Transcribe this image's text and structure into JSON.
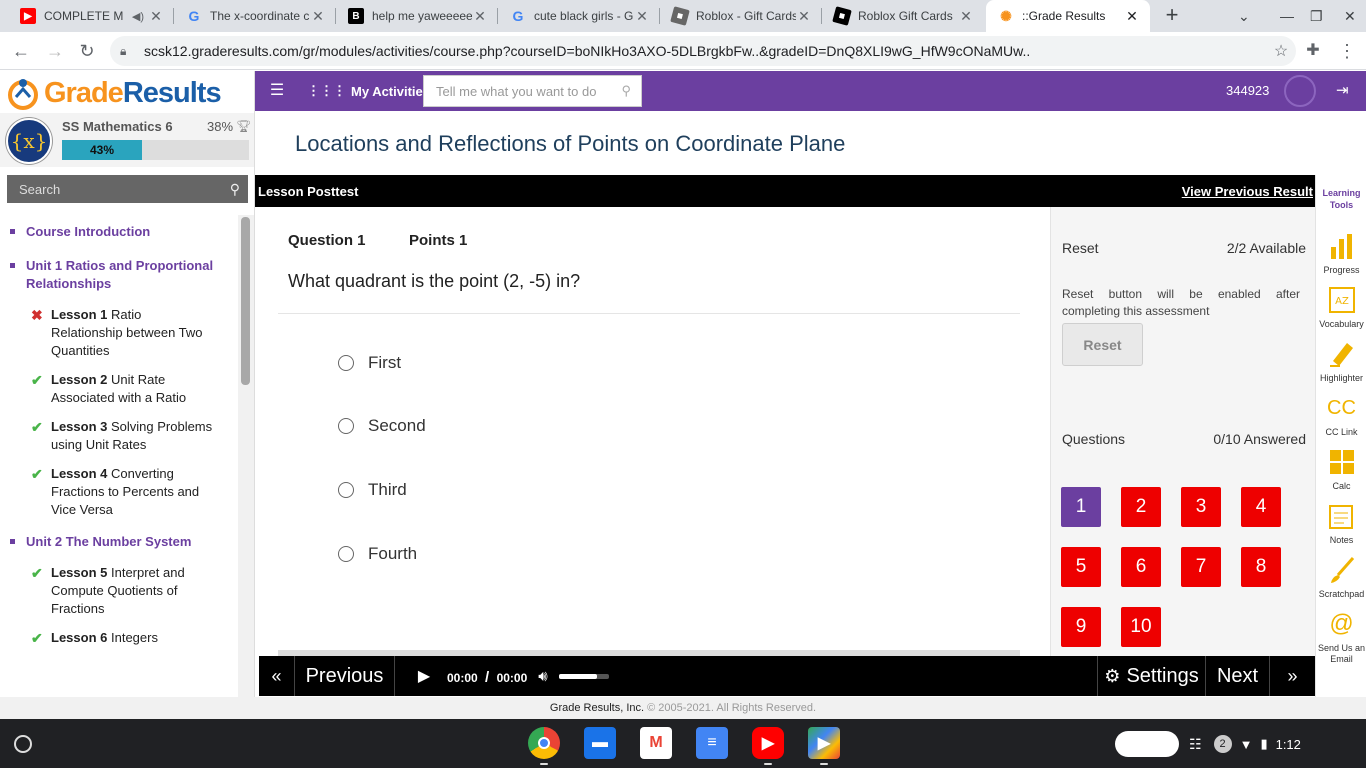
{
  "browser": {
    "tabs": [
      {
        "title": "COMPLETE M",
        "favicon": "youtube-icon",
        "color": "#ff0000"
      },
      {
        "title": "The x-coordinate c",
        "favicon": "google-icon",
        "color": "#4285f4"
      },
      {
        "title": "help me yaweeeee",
        "favicon": "brainly-icon",
        "color": "#000000"
      },
      {
        "title": "cute black girls - G",
        "favicon": "google-icon",
        "color": "#4285f4"
      },
      {
        "title": "Roblox - Gift Cards",
        "favicon": "roblox-icon",
        "color": "#555555"
      },
      {
        "title": "Roblox Gift Cards",
        "favicon": "roblox-icon",
        "color": "#000000"
      },
      {
        "title": "::Grade Results",
        "favicon": "graderesults-icon",
        "color": "#f7931e"
      }
    ],
    "url": "scsk12.graderesults.com/gr/modules/activities/course.php?courseID=boNIkHo3AXO-5DLBrgkbFw..&gradeID=DnQ8XLI9wG_HfW9cONaMUw.."
  },
  "logo": {
    "part1": "Grade",
    "part2": "Results"
  },
  "course": {
    "badge": "{x}",
    "name": "SS Mathematics 6",
    "percent_label": "38%",
    "progress_label": "43%",
    "progress": 0.43
  },
  "sidebar": {
    "search_placeholder": "Search",
    "items": [
      {
        "type": "unit",
        "label": "Course Introduction"
      },
      {
        "type": "unit",
        "label": "Unit 1 Ratios and Proportional Relationships"
      },
      {
        "type": "lesson",
        "status": "bad",
        "num": "Lesson 1",
        "label": "Ratio Relationship between Two Quantities"
      },
      {
        "type": "lesson",
        "status": "ok",
        "num": "Lesson 2",
        "label": "Unit Rate Associated with a Ratio"
      },
      {
        "type": "lesson",
        "status": "ok",
        "num": "Lesson 3",
        "label": "Solving Problems using Unit Rates"
      },
      {
        "type": "lesson",
        "status": "ok",
        "num": "Lesson 4",
        "label": "Converting Fractions to Percents and Vice Versa"
      },
      {
        "type": "unit",
        "label": "Unit 2 The Number System"
      },
      {
        "type": "lesson",
        "status": "ok",
        "num": "Lesson 5",
        "label": "Interpret and Compute Quotients of Fractions"
      },
      {
        "type": "lesson",
        "status": "ok",
        "num": "Lesson 6",
        "label": "Integers"
      }
    ]
  },
  "topbar": {
    "my_activities": "My Activities",
    "search_placeholder": "Tell me what you want to do",
    "user_id": "344923"
  },
  "page": {
    "title": "Locations and Reflections of Points on Coordinate Plane",
    "posttest_label": "Lesson Posttest",
    "view_previous": "View Previous Result"
  },
  "question": {
    "number_label": "Question 1",
    "points_label": "Points 1",
    "text": "What quadrant is the point (2, -5) in?",
    "choices": [
      "First",
      "Second",
      "Third",
      "Fourth"
    ]
  },
  "reset": {
    "title": "Reset",
    "available": "2/2 Available",
    "description": "Reset button will be enabled after completing this assessment",
    "button": "Reset"
  },
  "questions_panel": {
    "title": "Questions",
    "answered": "0/10 Answered",
    "numbers": [
      "1",
      "2",
      "3",
      "4",
      "5",
      "6",
      "7",
      "8",
      "9",
      "10"
    ],
    "current": "1"
  },
  "learning_tools": {
    "header": "Learning Tools",
    "items": [
      {
        "label": "Progress",
        "icon": "bar-chart-icon"
      },
      {
        "label": "Vocabulary",
        "icon": "az-book-icon"
      },
      {
        "label": "Highlighter",
        "icon": "highlighter-icon"
      },
      {
        "label": "CC Link",
        "icon": "cc-icon"
      },
      {
        "label": "Calc",
        "icon": "calculator-icon"
      },
      {
        "label": "Notes",
        "icon": "notes-icon"
      },
      {
        "label": "Scratchpad",
        "icon": "brush-icon"
      },
      {
        "label": "Send Us an Email",
        "icon": "at-icon"
      }
    ]
  },
  "player": {
    "previous": "Previous",
    "current_time": "00:00",
    "separator": "/",
    "duration": "00:00",
    "settings": "Settings",
    "next": "Next"
  },
  "footer": {
    "company": "Grade Results, Inc.",
    "copyright": "© 2005-2021. All Rights Reserved."
  },
  "shelf": {
    "notifications": "2",
    "time": "1:12"
  }
}
